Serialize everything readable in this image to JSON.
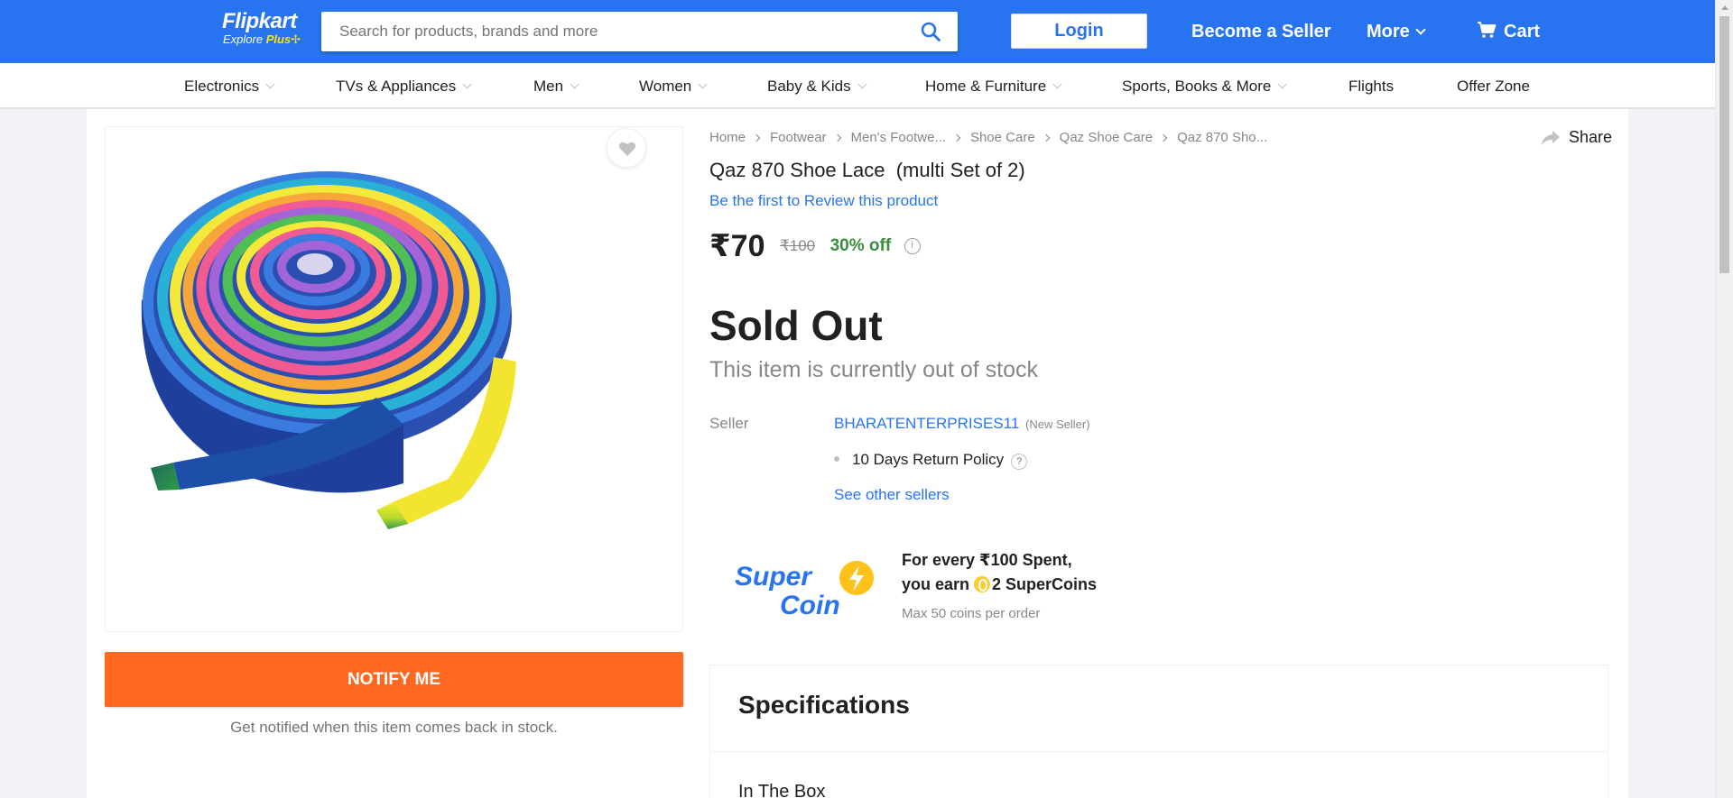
{
  "header": {
    "logo_brand": "Flipkart",
    "logo_tag_prefix": "Explore ",
    "logo_tag_plus": "Plus",
    "search_placeholder": "Search for products, brands and more",
    "login_label": "Login",
    "become_seller_label": "Become a Seller",
    "more_label": "More",
    "cart_label": "Cart",
    "brand_color": "#2874f0"
  },
  "categories": [
    {
      "label": "Electronics",
      "has_dropdown": true
    },
    {
      "label": "TVs & Appliances",
      "has_dropdown": true
    },
    {
      "label": "Men",
      "has_dropdown": true
    },
    {
      "label": "Women",
      "has_dropdown": true
    },
    {
      "label": "Baby & Kids",
      "has_dropdown": true
    },
    {
      "label": "Home & Furniture",
      "has_dropdown": true
    },
    {
      "label": "Sports, Books & More",
      "has_dropdown": true
    },
    {
      "label": "Flights",
      "has_dropdown": false
    },
    {
      "label": "Offer Zone",
      "has_dropdown": false
    }
  ],
  "product": {
    "breadcrumbs": [
      "Home",
      "Footwear",
      "Men's Footwe...",
      "Shoe Care",
      "Qaz Shoe Care",
      "Qaz 870 Sho..."
    ],
    "share_label": "Share",
    "title": "Qaz 870 Shoe Lace  (multi Set of 2)",
    "review_link": "Be the first to Review this product",
    "price": "₹70",
    "mrp": "₹100",
    "discount": "30% off",
    "status": "Sold Out",
    "status_note": "This item is currently out of stock",
    "notify_button": "NOTIFY ME",
    "notify_note": "Get notified when this item comes back in stock.",
    "image_alt_icon": "shoe-lace-product-image"
  },
  "seller": {
    "label": "Seller",
    "name": "BHARATENTERPRISES11",
    "badge": "(New Seller)",
    "policy": "10 Days Return Policy",
    "policy_help": "?",
    "other_sellers_link": "See other sellers"
  },
  "supercoin": {
    "logo_line1": "Super",
    "logo_line2": "Coin",
    "line1": "For every ₹100 Spent,",
    "line2_prefix": "you earn ",
    "line2_suffix": "2 SuperCoins",
    "line3": "Max 50 coins per order"
  },
  "specifications": {
    "title": "Specifications",
    "first_section": "In The Box"
  },
  "colors": {
    "notify_button": "#ff681e",
    "discount_green": "#388e3c",
    "link_blue": "#2874f0"
  }
}
